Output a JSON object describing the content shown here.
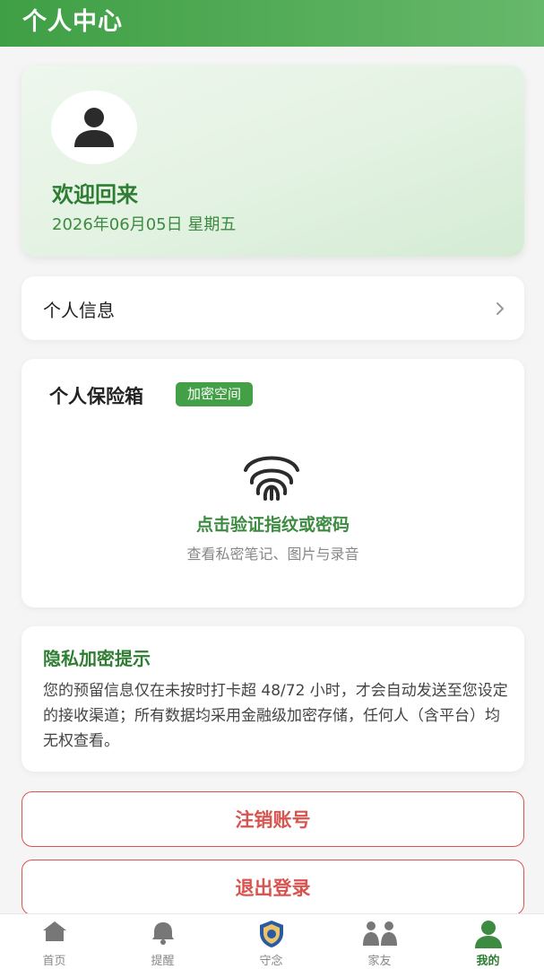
{
  "header": {
    "title": "个人中心"
  },
  "welcome": {
    "greeting": "欢迎回来",
    "date": "2026年06月05日 星期五"
  },
  "profile_item": {
    "label": "个人信息"
  },
  "vault": {
    "title": "个人保险箱",
    "badge": "加密空间",
    "prompt": "点击验证指纹或密码",
    "subtitle": "查看私密笔记、图片与录音"
  },
  "privacy": {
    "title": "隐私加密提示",
    "body": "您的预留信息仅在未按时打卡超 48/72 小时，才会自动发送至您设定的接收渠道；所有数据均采用金融级加密存储，任何人（含平台）均无权查看。"
  },
  "actions": {
    "cancel_account": "注销账号",
    "logout": "退出登录"
  },
  "tabs": [
    {
      "label": "首页",
      "icon": "home-icon"
    },
    {
      "label": "提醒",
      "icon": "bell-icon"
    },
    {
      "label": "守念",
      "icon": "shield-icon"
    },
    {
      "label": "家友",
      "icon": "family-icon"
    },
    {
      "label": "我的",
      "icon": "user-icon",
      "active": true
    }
  ],
  "colors": {
    "primary": "#43a047",
    "danger": "#d9534f"
  }
}
